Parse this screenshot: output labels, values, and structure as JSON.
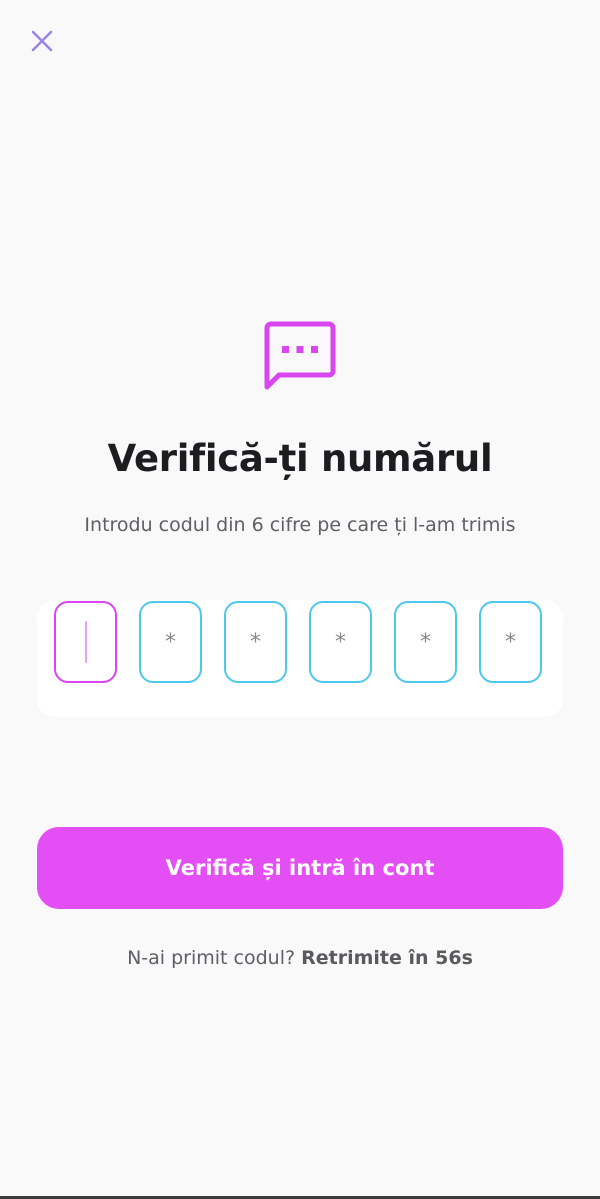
{
  "header": {
    "close_icon": "close-icon"
  },
  "main": {
    "icon": "message-dots-icon",
    "title": "Verifică-ți numărul",
    "subtitle": "Introdu codul din 6 cifre pe care ți l-am trimis",
    "otp": {
      "digits": [
        "",
        "*",
        "*",
        "*",
        "*",
        "*"
      ],
      "active_index": 0
    },
    "submit_label": "Verifică și intră în cont",
    "resend_prefix": "N-ai primit codul?",
    "resend_action": "Retrimite în 56s"
  },
  "colors": {
    "accent": "#e44ff5",
    "icon": "#d946ef",
    "close": "#9b86e8",
    "otp_border": "#4ec8ea",
    "background": "#f9f9f9"
  }
}
